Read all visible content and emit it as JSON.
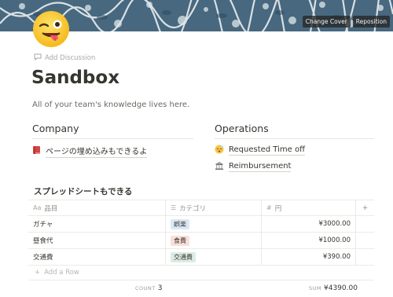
{
  "cover": {
    "change_cover_label": "Change Cover",
    "reposition_label": "Reposition"
  },
  "page": {
    "icon": "winking-face-with-tongue-icon",
    "add_discussion_label": "Add Discussion",
    "title": "Sandbox",
    "description": "All of your team's knowledge lives here."
  },
  "company": {
    "heading": "Company",
    "items": [
      {
        "icon": "red-book-icon",
        "label": "ページの埋め込みもできるよ"
      }
    ]
  },
  "operations": {
    "heading": "Operations",
    "items": [
      {
        "icon": "sleeping-face-icon",
        "label": "Requested Time off"
      },
      {
        "icon": "bank-icon",
        "label": "Reimbursement"
      }
    ]
  },
  "table": {
    "title": "スプレッドシートもできる",
    "columns": [
      {
        "icon": "Aa",
        "label": "品目"
      },
      {
        "icon": "☰",
        "label": "カテゴリ"
      },
      {
        "icon": "#",
        "label": "円"
      }
    ],
    "add_column_label": "+",
    "rows": [
      {
        "item": "ガチャ",
        "category": "娯楽",
        "tag_color": "#dbe8f5",
        "amount": "¥3000.00"
      },
      {
        "item": "昼食代",
        "category": "食費",
        "tag_color": "#f9dfd9",
        "amount": "¥1000.00"
      },
      {
        "item": "交通費",
        "category": "交通費",
        "tag_color": "#dcece3",
        "amount": "¥390.00"
      }
    ],
    "add_row_label": "Add a Row",
    "footer": {
      "count_label": "COUNT",
      "count_value": "3",
      "sum_label": "SUM",
      "sum_value": "¥4390.00"
    }
  }
}
